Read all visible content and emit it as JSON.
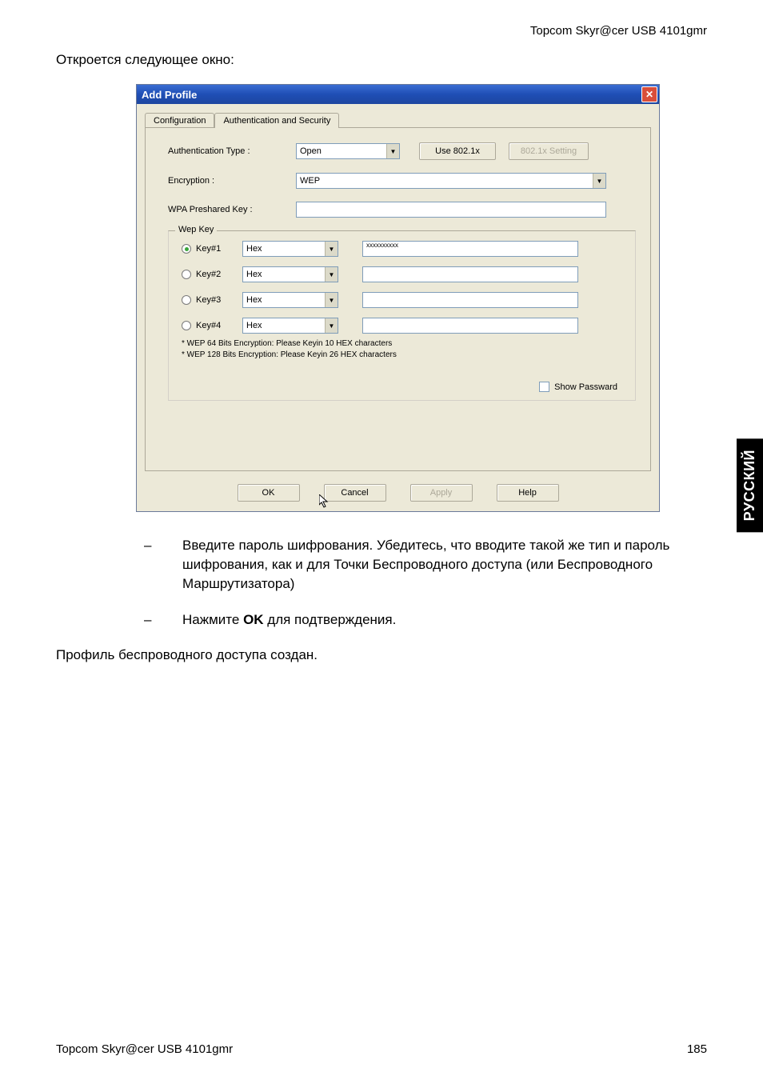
{
  "page": {
    "header_right": "Topcom Skyr@cer USB 4101gmr",
    "intro": "Откроется следующее окно:",
    "footer_left": "Topcom Skyr@cer USB 4101gmr",
    "footer_right": "185",
    "side_tab": "РУССКИЙ"
  },
  "dialog": {
    "title": "Add Profile",
    "tabs": {
      "configuration": "Configuration",
      "auth_security": "Authentication and Security"
    },
    "labels": {
      "auth_type": "Authentication Type :",
      "encryption": "Encryption :",
      "wpa_psk": "WPA Preshared Key :",
      "wep_key_group": "Wep Key"
    },
    "values": {
      "auth_type": "Open",
      "encryption": "WEP",
      "use8021x_btn": "Use 802.1x",
      "setting8021x_btn": "802.1x Setting"
    },
    "keys": [
      {
        "label": "Key#1",
        "format": "Hex",
        "value": "xxxxxxxxxx",
        "selected": true
      },
      {
        "label": "Key#2",
        "format": "Hex",
        "value": "",
        "selected": false
      },
      {
        "label": "Key#3",
        "format": "Hex",
        "value": "",
        "selected": false
      },
      {
        "label": "Key#4",
        "format": "Hex",
        "value": "",
        "selected": false
      }
    ],
    "hint1": "* WEP 64 Bits Encryption:   Please Keyin 10 HEX characters",
    "hint2": "* WEP 128 Bits Encryption:   Please Keyin 26 HEX characters",
    "show_password": "Show Passward",
    "buttons": {
      "ok": "OK",
      "cancel": "Cancel",
      "apply": "Apply",
      "help": "Help"
    }
  },
  "bullets": {
    "item1": "Введите пароль шифрования. Убедитесь, что вводите такой же тип и пароль шифрования, как и для Точки Беспроводного доступа (или Беспроводного Маршрутизатора)",
    "item2_prefix": "Нажмите ",
    "item2_bold": "OK",
    "item2_suffix": " для подтверждения."
  },
  "profile_created": "Профиль беспроводного доступа создан."
}
